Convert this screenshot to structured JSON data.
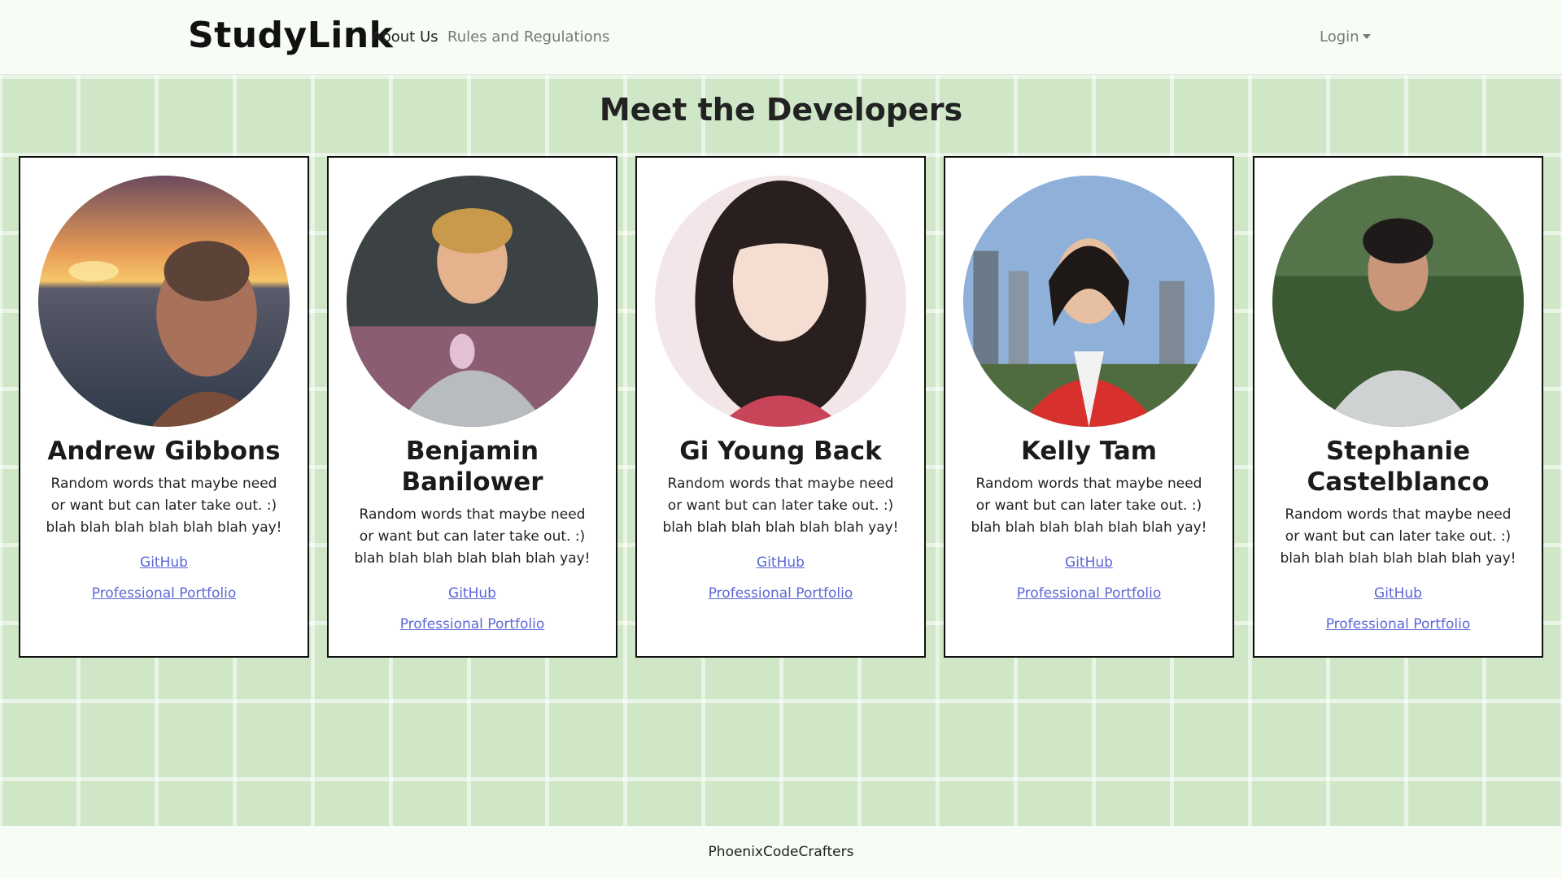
{
  "nav": {
    "brand": "StudyLink",
    "about": "About Us",
    "rules": "Rules and Regulations",
    "login": "Login"
  },
  "main": {
    "title": "Meet the Developers"
  },
  "developers": [
    {
      "name": "Andrew Gibbons",
      "desc": "Random words that maybe need or want but can later take out. :) blah blah blah blah blah blah yay!",
      "github": "GitHub",
      "portfolio": "Professional Portfolio"
    },
    {
      "name": "Benjamin Banilower",
      "desc": "Random words that maybe need or want but can later take out. :) blah blah blah blah blah blah yay!",
      "github": "GitHub",
      "portfolio": "Professional Portfolio"
    },
    {
      "name": "Gi Young Back",
      "desc": "Random words that maybe need or want but can later take out. :) blah blah blah blah blah blah yay!",
      "github": "GitHub",
      "portfolio": "Professional Portfolio"
    },
    {
      "name": "Kelly Tam",
      "desc": "Random words that maybe need or want but can later take out. :) blah blah blah blah blah blah yay!",
      "github": "GitHub",
      "portfolio": "Professional Portfolio"
    },
    {
      "name": "Stephanie Castelblanco",
      "desc": "Random words that maybe need or want but can later take out. :) blah blah blah blah blah blah yay!",
      "github": "GitHub",
      "portfolio": "Professional Portfolio"
    }
  ],
  "footer": {
    "text": "PhoenixCodeCrafters"
  }
}
